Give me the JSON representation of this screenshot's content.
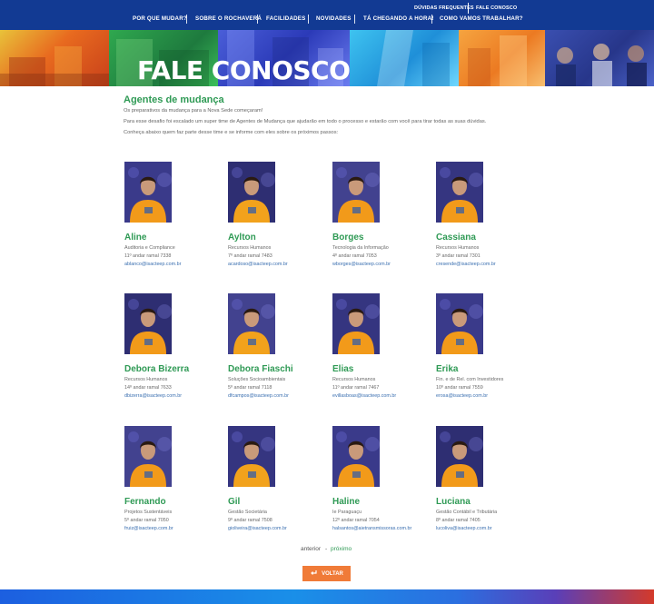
{
  "utility_nav": {
    "faq": "DÚVIDAS FREQUENTES",
    "contact": "FALE CONOSCO"
  },
  "main_nav": [
    "POR QUE MUDAR?",
    "SOBRE O ROCHAVERÁ",
    "FACILIDADES",
    "NOVIDADES",
    "TÁ CHEGANDO A HORA!",
    "COMO VAMOS TRABALHAR?"
  ],
  "hero": {
    "title": "FALE CONOSCO"
  },
  "section": {
    "heading": "Agentes de mudança",
    "intro": [
      "Os preparativos da mudança para a Nova Sede começaram!",
      "Para esse desafio foi escalado um super time de Agentes de Mudança que ajudarão em todo o processo e estarão com você para tirar todas as suas dúvidas.",
      "Conheça abaixo quem faz parte desse time e se informe com eles sobre os próximos passos:"
    ]
  },
  "agents": [
    {
      "name": "Aline",
      "dept": "Auditoria e Compliance",
      "location": "11º andar ramal 7338",
      "email": "ablanco@isacteep.com.br"
    },
    {
      "name": "Aylton",
      "dept": "Recursos Humanos",
      "location": "7º andar ramal 7483",
      "email": "acardoso@isacteep.com.br"
    },
    {
      "name": "Borges",
      "dept": "Tecnologia da Informação",
      "location": "4º andar ramal 7053",
      "email": "wborges@isacteep.com.br"
    },
    {
      "name": "Cassiana",
      "dept": "Recursos Humanos",
      "location": "3º andar ramal 7301",
      "email": "cresende@isacteep.com.br"
    },
    {
      "name": "Debora Bizerra",
      "dept": "Recursos Humanos",
      "location": "14º andar ramal 7633",
      "email": "dbizerra@isacteep.com.br"
    },
    {
      "name": "Debora Fiaschi",
      "dept": "Soluções Socioambientais",
      "location": "5º andar ramal 7118",
      "email": "dfcampos@isacteep.com.br"
    },
    {
      "name": "Elias",
      "dept": "Recursos Humanos",
      "location": "11º andar ramal 7467",
      "email": "evillasboas@isacteep.com.br"
    },
    {
      "name": "Erika",
      "dept": "Fin. e de Rel. com Investidores",
      "location": "10º andar ramal 7559",
      "email": "erosa@isacteep.com.br"
    },
    {
      "name": "Fernando",
      "dept": "Projetos Sustentáveis",
      "location": "5º andar ramal 7050",
      "email": "fruiz@isacteep.com.br"
    },
    {
      "name": "Gil",
      "dept": "Gestão Societária",
      "location": "9º andar ramal 7508",
      "email": "gioliveira@isacteep.com.br"
    },
    {
      "name": "Haline",
      "dept": "Ie Paraguaçu",
      "location": "12º andar ramal 7054",
      "email": "halsantos@aietransmissoras.com.br"
    },
    {
      "name": "Luciana",
      "dept": "Gestão Contábil e Tributária",
      "location": "8º andar ramal 7405",
      "email": "lucoliva@isacteep.com.br"
    }
  ],
  "pagination": {
    "prev": "anterior",
    "separator": "-",
    "next": "próximo"
  },
  "back_button": {
    "label": "VOLTAR",
    "icon": "return-arrow-icon"
  },
  "colors": {
    "nav_bg": "#123a93",
    "heading_green": "#2f9a55",
    "button_orange": "#f07b38",
    "link_blue": "#3a6fb0"
  }
}
